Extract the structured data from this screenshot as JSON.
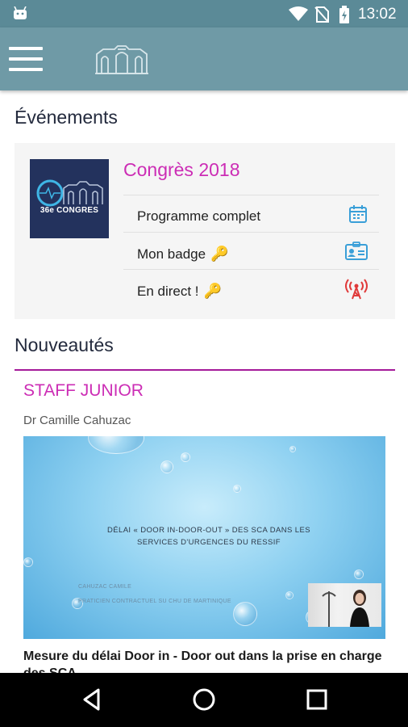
{
  "status_bar": {
    "time": "13:02",
    "icons": [
      "android-icon",
      "wifi-icon",
      "no-sim-icon",
      "battery-icon"
    ]
  },
  "app_bar": {
    "menu_icon": "hamburger-menu-icon",
    "logo": "building-logo"
  },
  "events": {
    "heading": "Événements",
    "card": {
      "thumbnail_text": "36e CONGRES",
      "title": "Congrès 2018",
      "links": [
        {
          "label": "Programme complet",
          "icon": "calendar-icon",
          "locked": false
        },
        {
          "label": "Mon badge",
          "icon": "id-badge-icon",
          "locked": true
        },
        {
          "label": "En direct !",
          "icon": "broadcast-tower-icon",
          "locked": true
        }
      ]
    }
  },
  "news": {
    "heading": "Nouveautés",
    "item": {
      "category": "STAFF JUNIOR",
      "author": "Dr Camille Cahuzac",
      "slide_title_line1": "DÉLAI « DOOR IN-DOOR-OUT » DES SCA DANS LES",
      "slide_title_line2": "SERVICES D'URGENCES DU RESSIF",
      "slide_author": "CAHUZAC CAMILE",
      "slide_role": "PRATICIEN CONTRACTUEL SU CHU DE MARTINIQUE",
      "caption": "Mesure du délai Door in - Door out dans la prise en charge des SCA"
    }
  },
  "nav_bar": {
    "buttons": [
      "back-button",
      "home-button",
      "recents-button"
    ]
  },
  "colors": {
    "status_bar": "#5b8a97",
    "app_bar": "#6f9aa6",
    "accent": "#cc2db5",
    "divider": "#a51a9a",
    "icon_blue": "#3a9fd8",
    "icon_red": "#e03a3a",
    "key_gold": "#f3b32a"
  }
}
